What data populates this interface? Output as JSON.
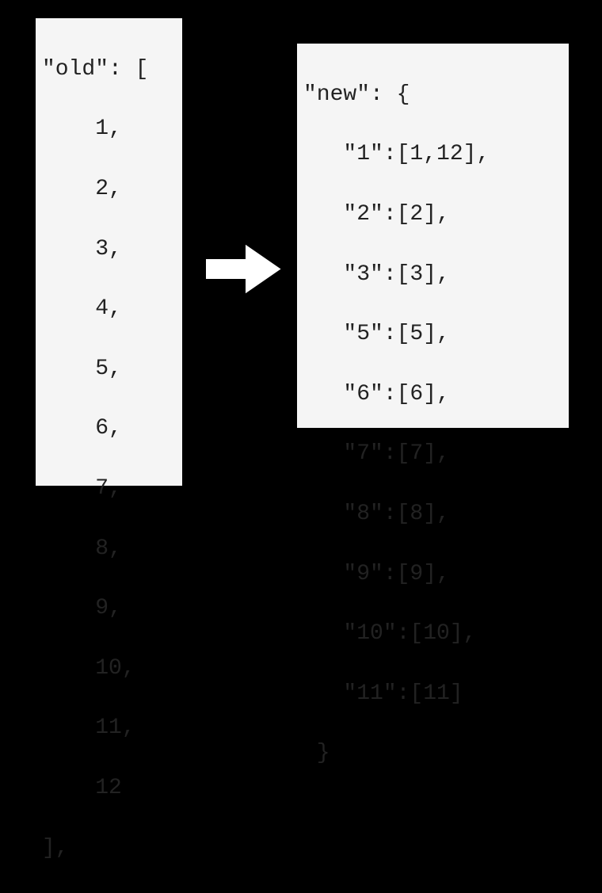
{
  "left": {
    "l0": "\"old\": [",
    "l1": "    1,",
    "l2": "    2,",
    "l3": "    3,",
    "l4": "    4,",
    "l5": "    5,",
    "l6": "    6,",
    "l7": "    7,",
    "l8": "    8,",
    "l9": "    9,",
    "l10": "    10,",
    "l11": "    11,",
    "l12": "    12",
    "l13": "],"
  },
  "right": {
    "r0": "\"new\": {",
    "r1": "   \"1\":[1,12],",
    "r2": "   \"2\":[2],",
    "r3": "   \"3\":[3],",
    "r4": "   \"5\":[5],",
    "r5": "   \"6\":[6],",
    "r6": "   \"7\":[7],",
    "r7": "   \"8\":[8],",
    "r8": "   \"9\":[9],",
    "r9": "   \"10\":[10],",
    "r10": "   \"11\":[11]",
    "r11": " }"
  }
}
